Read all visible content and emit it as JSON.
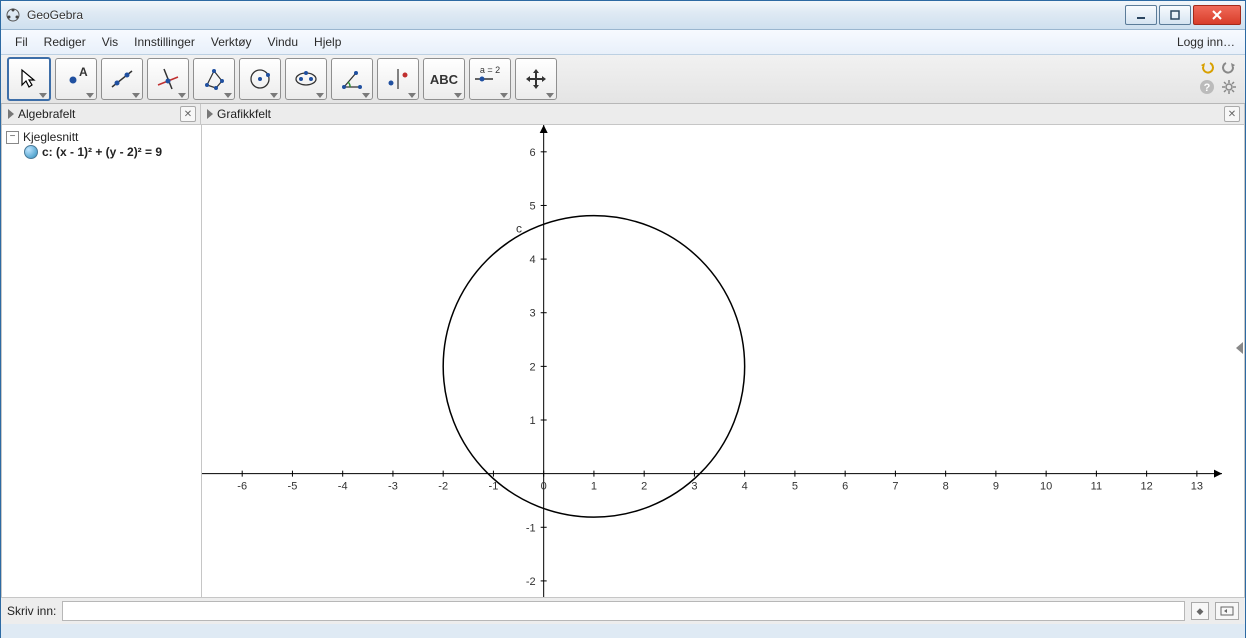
{
  "window": {
    "title": "GeoGebra"
  },
  "menu": {
    "items": [
      "Fil",
      "Rediger",
      "Vis",
      "Innstillinger",
      "Verktøy",
      "Vindu",
      "Hjelp"
    ],
    "right": "Logg inn…"
  },
  "toolbar": {
    "tools": [
      {
        "name": "move-tool",
        "selected": true
      },
      {
        "name": "point-tool"
      },
      {
        "name": "line-tool"
      },
      {
        "name": "perpendicular-tool"
      },
      {
        "name": "polygon-tool"
      },
      {
        "name": "circle-tool"
      },
      {
        "name": "ellipse-tool"
      },
      {
        "name": "angle-tool"
      },
      {
        "name": "reflect-tool"
      },
      {
        "name": "text-tool",
        "label": "ABC"
      },
      {
        "name": "slider-tool",
        "label": "a = 2"
      },
      {
        "name": "move-graphics-tool"
      }
    ]
  },
  "panels": {
    "algebra_title": "Algebrafelt",
    "graphics_title": "Grafikkfelt",
    "group_label": "Kjeglesnitt",
    "object_label": "c: (x - 1)² + (y - 2)² = 9"
  },
  "inputbar": {
    "label": "Skriv inn:",
    "value": ""
  },
  "chart_data": {
    "type": "scatter",
    "title": "",
    "xlabel": "",
    "ylabel": "",
    "xlim": [
      -6.8,
      13.5
    ],
    "ylim": [
      -2.3,
      6.5
    ],
    "xticks": [
      -6,
      -5,
      -4,
      -3,
      -2,
      -1,
      0,
      1,
      2,
      3,
      4,
      5,
      6,
      7,
      8,
      9,
      10,
      11,
      12,
      13
    ],
    "yticks": [
      -2,
      -1,
      0,
      1,
      2,
      3,
      4,
      5,
      6
    ],
    "objects": [
      {
        "name": "c",
        "type": "circle",
        "center": [
          1,
          2
        ],
        "radius": 3,
        "label_position": [
          -0.55,
          4.5
        ]
      }
    ]
  }
}
